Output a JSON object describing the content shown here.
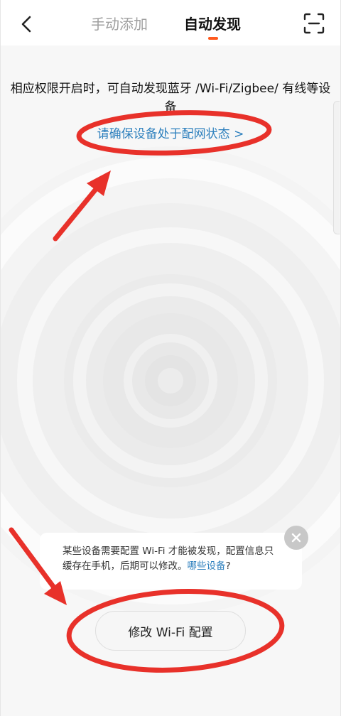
{
  "header": {
    "tabs": [
      {
        "label": "手动添加",
        "active": false
      },
      {
        "label": "自动发现",
        "active": true
      }
    ],
    "accent_color": "#ff5a1f"
  },
  "main": {
    "description": "相应权限开启时，可自动发现蓝牙 /Wi-Fi/Zigbee/ 有线等设备",
    "guide_link": "请确保设备处于配网状态 >"
  },
  "tip": {
    "text": "某些设备需要配置 Wi-Fi 才能被发现，配置信息只缓存在手机，后期可以修改。",
    "link": "哪些设备",
    "suffix": "?",
    "link_color": "#2c7fbd"
  },
  "actions": {
    "wifi_config_label": "修改 Wi-Fi 配置"
  },
  "icons": {
    "back": "chevron-left-icon",
    "scan": "scan-icon",
    "close": "close-icon"
  },
  "annotation_color": "#e8312a"
}
